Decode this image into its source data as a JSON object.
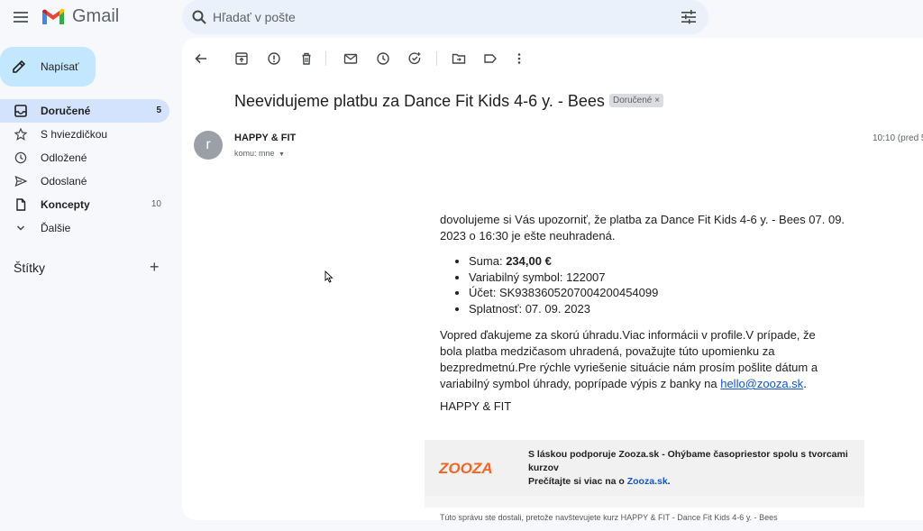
{
  "app": {
    "name": "Gmail"
  },
  "search": {
    "placeholder": "Hľadať v pošte"
  },
  "compose": {
    "label": "Napísať"
  },
  "sidebar": {
    "items": [
      {
        "label": "Doručené",
        "count": "5",
        "icon": "inbox-icon",
        "active": true,
        "bold": true
      },
      {
        "label": "S hviezdičkou",
        "count": "",
        "icon": "star-icon"
      },
      {
        "label": "Odložené",
        "count": "",
        "icon": "clock-icon"
      },
      {
        "label": "Odoslané",
        "count": "",
        "icon": "send-icon"
      },
      {
        "label": "Koncepty",
        "count": "10",
        "icon": "draft-icon",
        "bold": true
      },
      {
        "label": "Ďalšie",
        "count": "",
        "icon": "chevron-down-icon"
      }
    ],
    "labels_title": "Štítky",
    "labels_add": "+"
  },
  "toolbar": {
    "icons": [
      "back-icon",
      "archive-icon",
      "report-spam-icon",
      "delete-icon",
      "mark-unread-icon",
      "snooze-icon",
      "add-task-icon",
      "move-to-icon",
      "label-icon",
      "more-icon"
    ]
  },
  "email": {
    "subject": "Neevidujeme platbu za Dance Fit Kids 4-6 y. - Bees",
    "tag": "Doručené",
    "tag_close": "×",
    "avatar_letter": "r",
    "sender": "HAPPY & FIT",
    "recipient": "komu: mne",
    "time": "10:10 (pred 5",
    "intro": "dovolujeme si Vás upozorniť, že platba za Dance Fit Kids 4-6 y. - Bees 07. 09. 2023 o 16:30 je ešte neuhradená.",
    "details": {
      "amount_label": "Suma:",
      "amount": "234,00 €",
      "vs": "Variabilný symbol: 122007",
      "account": "Účet: SK9383605207004200454099",
      "due": "Splatnosť: 07. 09. 2023"
    },
    "message_text": "Vopred ďakujeme za skorú úhradu.Viac informácii v profile.V prípade, že bola platba medzičasom uhradená, považujte túto upomienku za bezpredmetnú.Pre rýchle vyriešenie situácie nám prosím pošlite dátum a variabilný symbol úhrady, poprípade výpis z banky na",
    "message_link": "hello@zooza.sk",
    "message_end": ".",
    "signature": "HAPPY & FIT",
    "banner": {
      "logo_text": "ZOOZA",
      "line1": "S láskou podporuje Zooza.sk - Ohýbame časopriestor spolu s tvorcami kurzov",
      "line2_prefix": "Prečítajte si viac na o",
      "line2_link": "Zooza.sk",
      "line2_suffix": "."
    },
    "footer": "Túto správu ste dostali, pretože navštevujete kurz HAPPY & FIT - Dance Fit Kids 4-6 y. - Bees"
  }
}
